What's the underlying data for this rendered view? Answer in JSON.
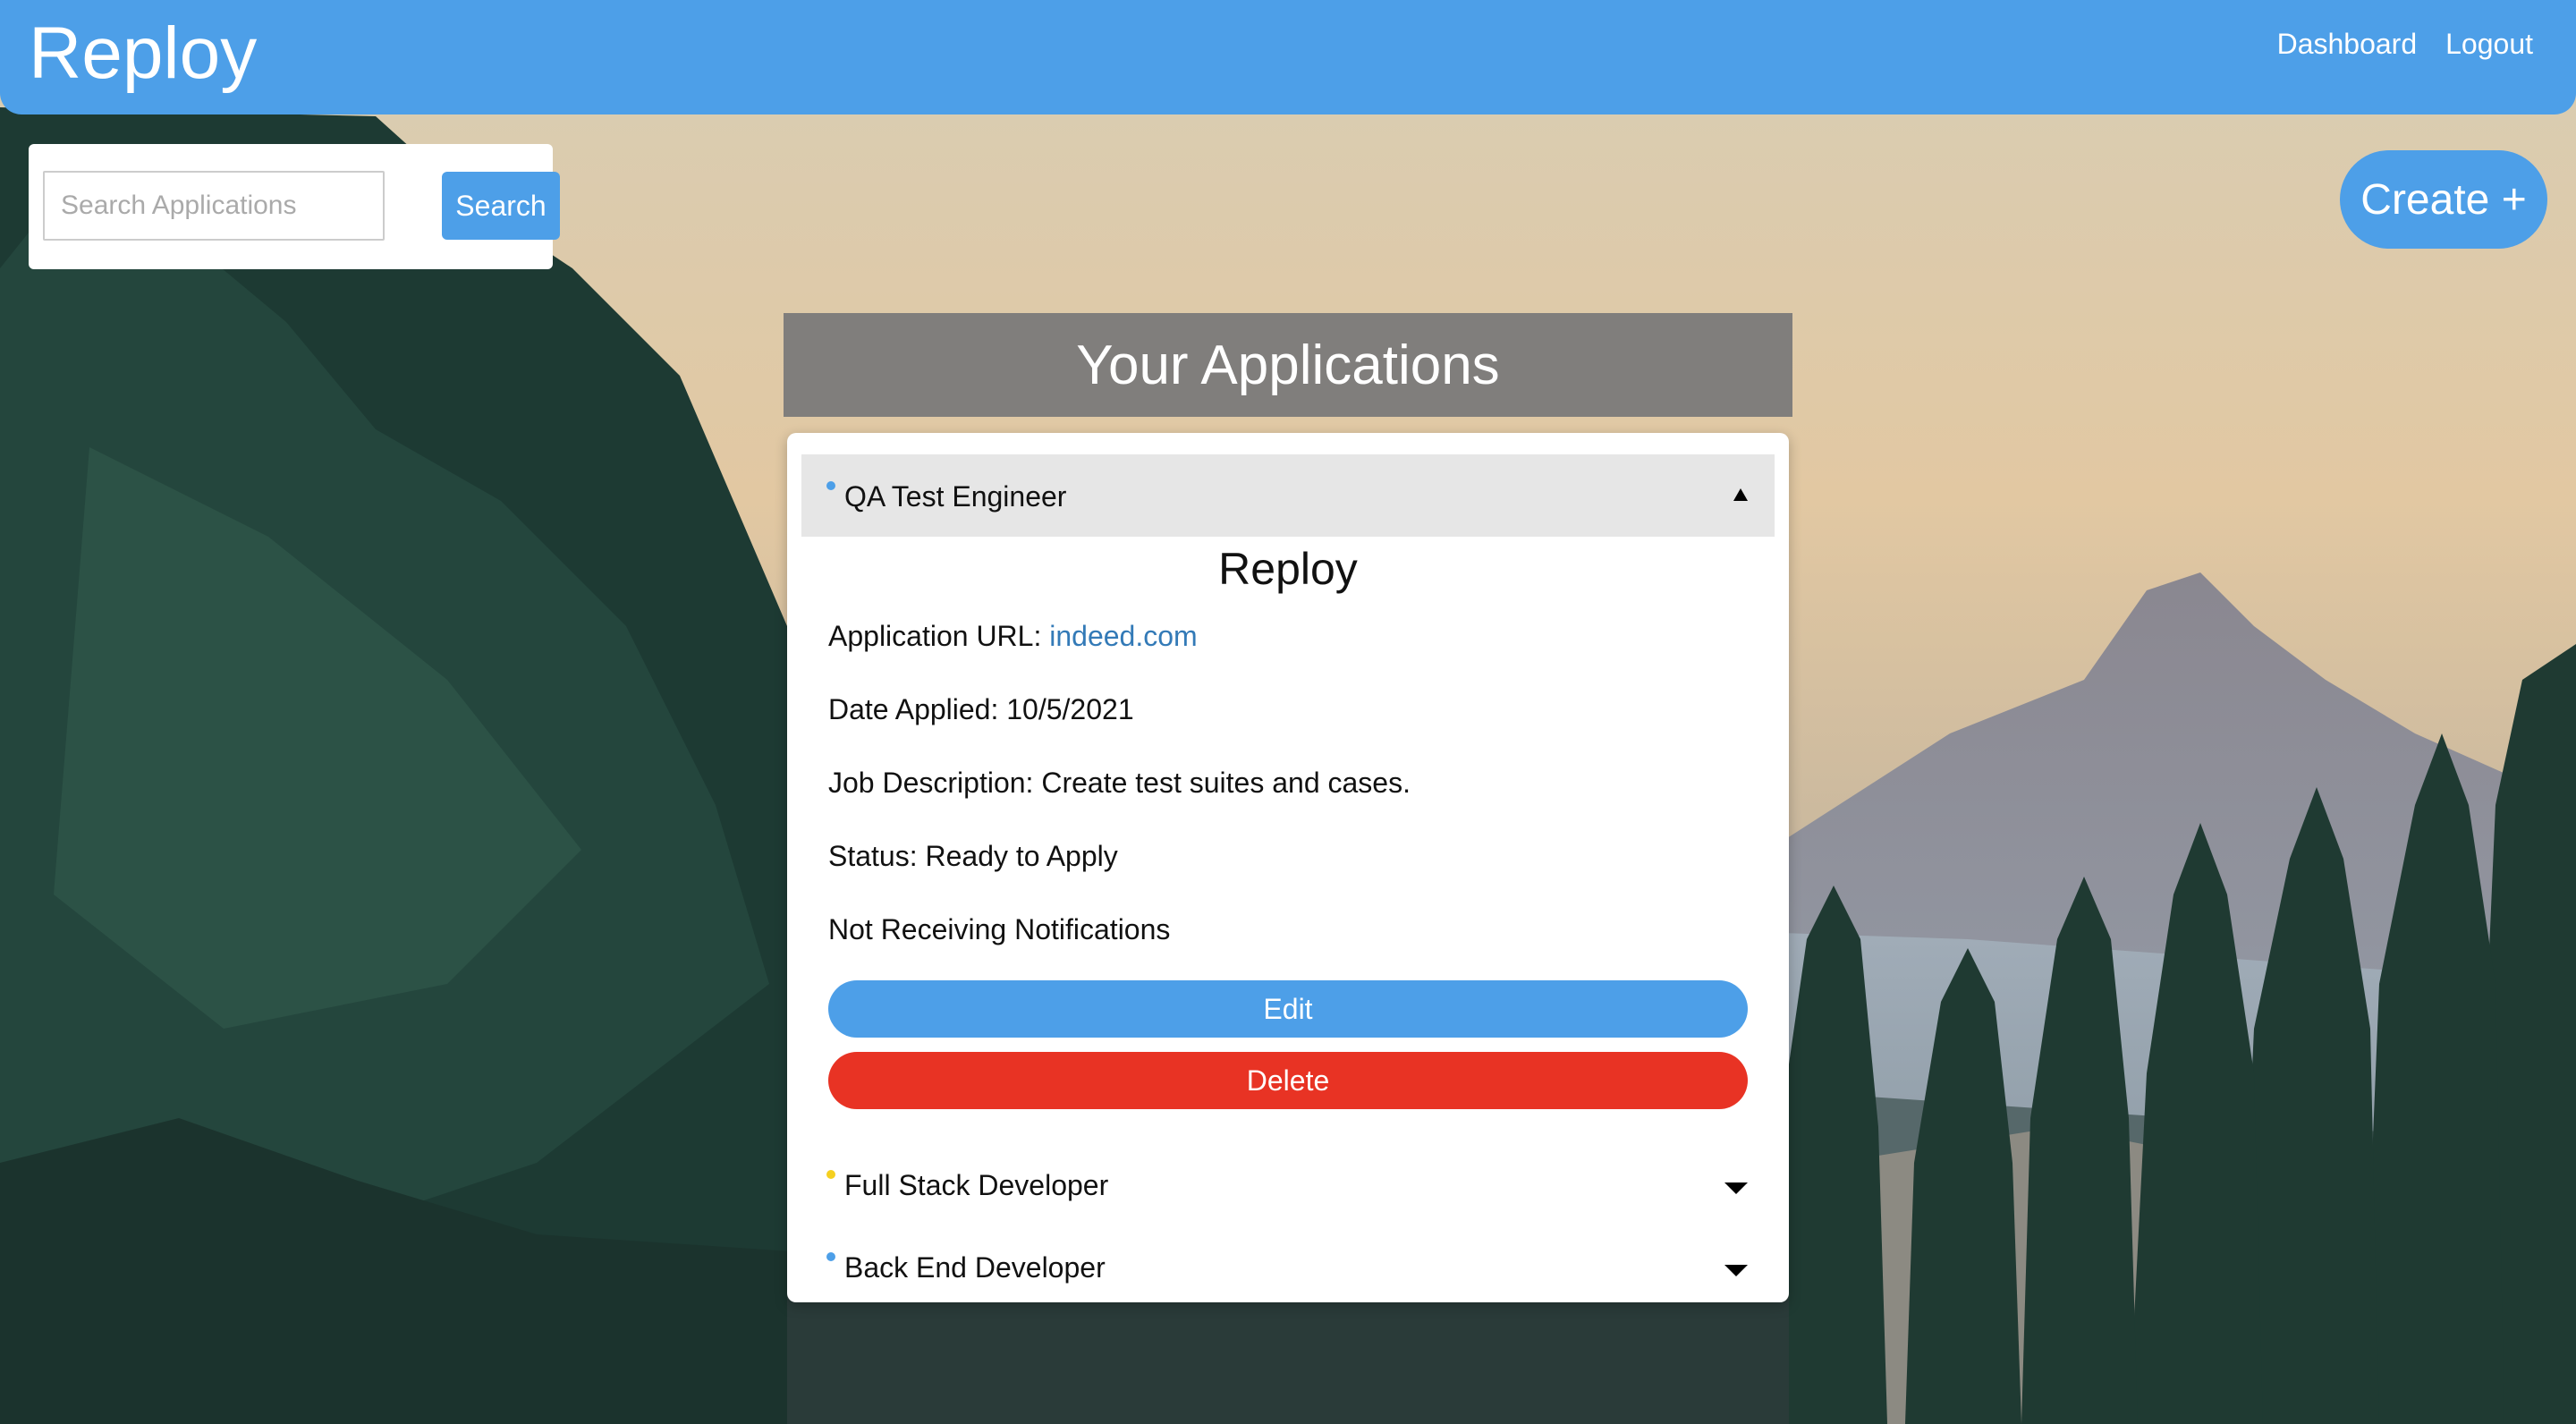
{
  "header": {
    "brand": "Reploy",
    "nav": [
      {
        "label": "Dashboard"
      },
      {
        "label": "Logout"
      }
    ]
  },
  "search": {
    "placeholder": "Search Applications",
    "value": "",
    "button_label": "Search"
  },
  "create_button_label": "Create +",
  "applications": {
    "title": "Your Applications",
    "expanded": {
      "job_title": "QA Test Engineer",
      "dot_color": "#4d9fe8",
      "company": "Reploy",
      "url_label": "Application URL: ",
      "url_text": "indeed.com",
      "date_label": "Date Applied: 10/5/2021",
      "description_label": "Job Description: Create test suites and cases.",
      "status_label": "Status: Ready to Apply",
      "notifications_label": "Not Receiving Notifications",
      "edit_label": "Edit",
      "delete_label": "Delete"
    },
    "collapsed": [
      {
        "job_title": "Full Stack Developer",
        "dot_color": "#f5d020"
      },
      {
        "job_title": "Back End Developer",
        "dot_color": "#4d9fe8"
      }
    ]
  },
  "colors": {
    "primary": "#4d9fe8",
    "danger": "#e83324",
    "link": "#337ab7",
    "title_bar": "#7a7a7a"
  }
}
